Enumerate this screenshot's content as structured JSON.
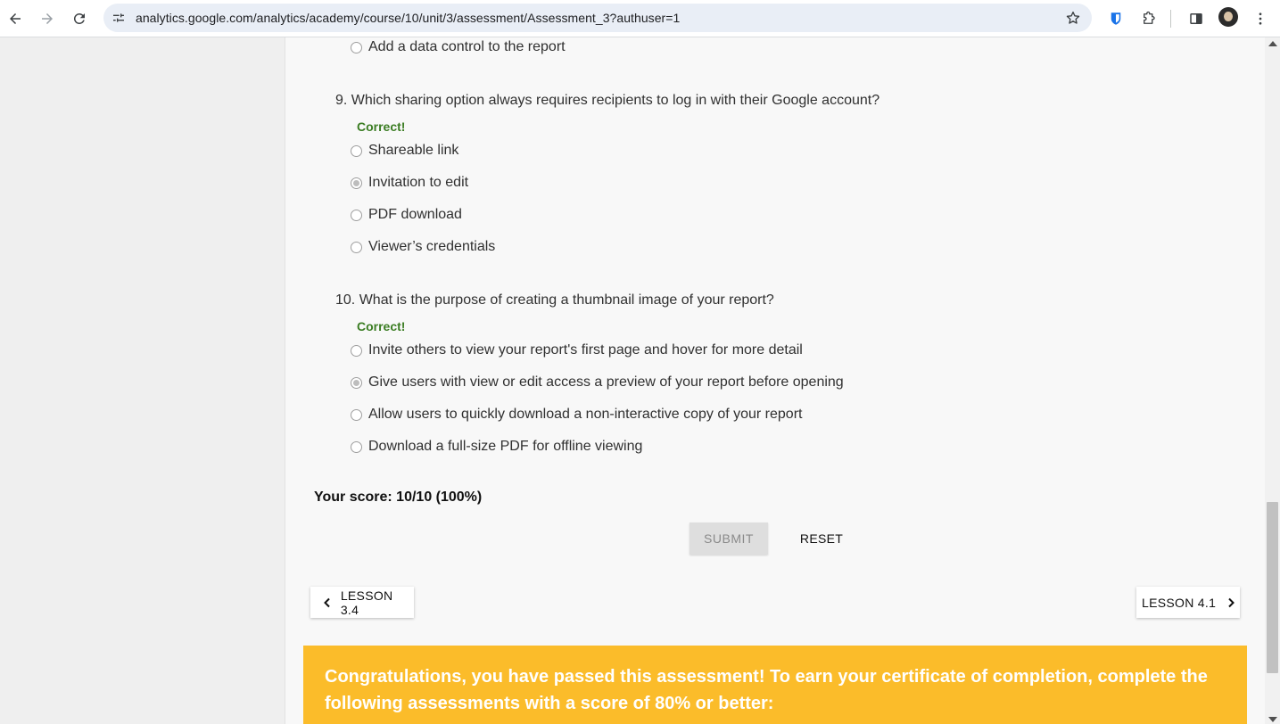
{
  "browser": {
    "url": "analytics.google.com/analytics/academy/course/10/unit/3/assessment/Assessment_3?authuser=1",
    "icons": [
      "back-icon",
      "forward-icon",
      "reload-icon",
      "site-settings-icon",
      "bookmark-star-icon",
      "bitwarden-icon",
      "extensions-icon",
      "side-panel-icon",
      "profile-avatar",
      "more-menu-icon"
    ]
  },
  "quiz": {
    "prev_question_option": "Add a data control to the report",
    "questions": [
      {
        "text": "9. Which sharing option always requires recipients to log in with their Google account?",
        "feedback": "Correct!",
        "options": [
          "Shareable link",
          "Invitation to edit",
          "PDF download",
          "Viewer’s credentials"
        ],
        "selected_index": 1
      },
      {
        "text": "10. What is the purpose of creating a thumbnail image of your report?",
        "feedback": "Correct!",
        "options": [
          "Invite others to view your report's first page and hover for more detail",
          "Give users with view or edit access a preview of your report before opening",
          "Allow users to quickly download a non-interactive copy of your report",
          "Download a full-size PDF for offline viewing"
        ],
        "selected_index": 1
      }
    ],
    "score": "Your score: 10/10 (100%)",
    "submit_label": "SUBMIT",
    "reset_label": "RESET"
  },
  "navigation": {
    "prev_label": "LESSON 3.4",
    "next_label": "LESSON 4.1"
  },
  "banner": {
    "text": "Congratulations, you have passed this assessment! To earn your certificate of completion, complete the following assessments with a score of 80% or better:",
    "color": "#fbbc2a"
  },
  "colors": {
    "correct": "#3b7d23",
    "page_bg": "#f8f8f8",
    "sidebar_bg": "#efefef"
  }
}
